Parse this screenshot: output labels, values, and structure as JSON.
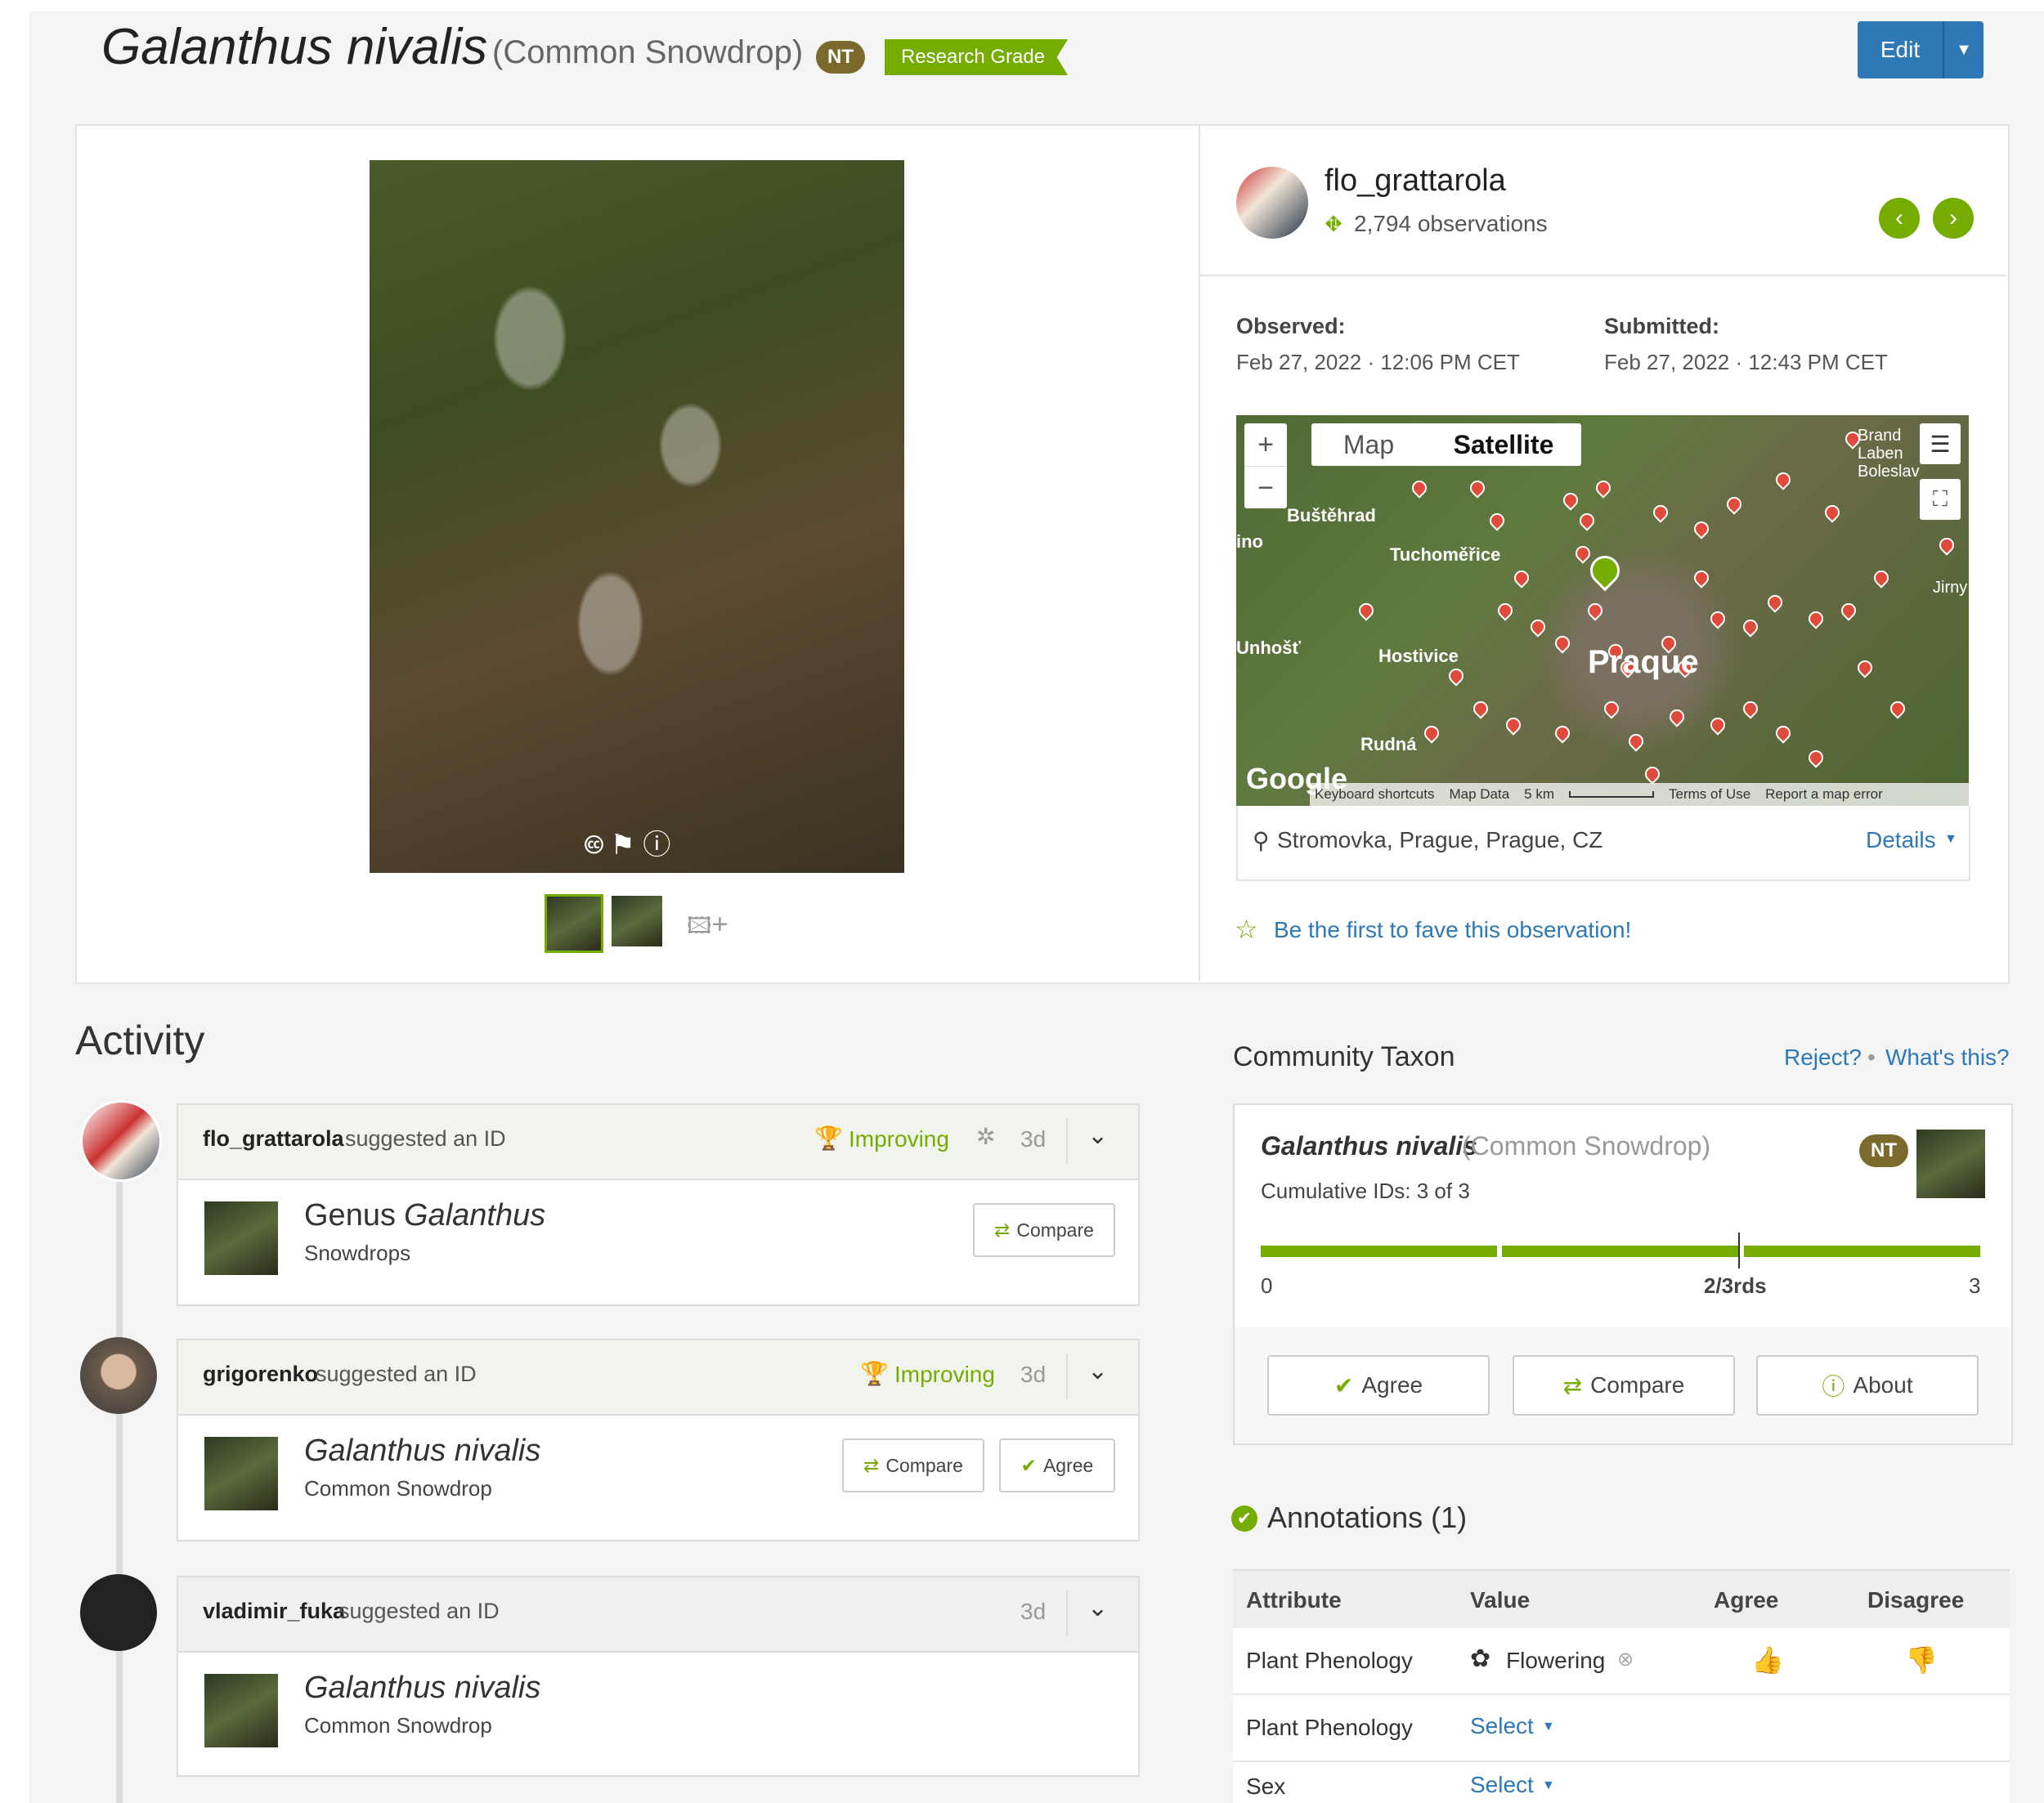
{
  "header": {
    "scientific_name": "Galanthus nivalis",
    "common_name": "(Common Snowdrop)",
    "status_badge": "NT",
    "quality_badge": "Research Grade",
    "edit_label": "Edit"
  },
  "observer": {
    "username": "flo_grattarola",
    "observation_count": "2,794 observations"
  },
  "dates": {
    "observed_label": "Observed:",
    "observed_value": "Feb 27, 2022 · 12:06 PM CET",
    "submitted_label": "Submitted:",
    "submitted_value": "Feb 27, 2022 · 12:43 PM CET"
  },
  "map": {
    "tab_map": "Map",
    "tab_satellite": "Satellite",
    "zoom_in": "+",
    "zoom_out": "−",
    "places": [
      "Buštěhrad",
      "Tuchoměřice",
      "Hostivice",
      "Praque",
      "Rudná",
      "Brand Laben Boleslav",
      "Jirny",
      "Unhošť",
      "ino"
    ],
    "google": "Google",
    "footer_items": [
      "Keyboard shortcuts",
      "Map Data",
      "5 km",
      "Terms of Use",
      "Report a map error"
    ],
    "location": "Stromovka, Prague, Prague, CZ",
    "details_label": "Details"
  },
  "fave_text": "Be the first to fave this observation!",
  "activity": {
    "title": "Activity",
    "items": [
      {
        "user": "flo_grattarola",
        "action": "suggested an ID",
        "status": "Improving",
        "age": "3d",
        "taxon_rank": "Genus",
        "taxon_name": "Galanthus",
        "taxon_common": "Snowdrops",
        "compare": "Compare"
      },
      {
        "user": "grigorenko",
        "action": "suggested an ID",
        "status": "Improving",
        "age": "3d",
        "taxon_name": "Galanthus nivalis",
        "taxon_common": "Common Snowdrop",
        "compare": "Compare",
        "agree": "Agree"
      },
      {
        "user": "vladimir_fuka",
        "action": "suggested an ID",
        "age": "3d",
        "taxon_name": "Galanthus nivalis",
        "taxon_common": "Common Snowdrop"
      }
    ]
  },
  "community": {
    "title": "Community Taxon",
    "reject": "Reject?",
    "whats_this": "What's this?",
    "taxon_name": "Galanthus nivalis",
    "taxon_common": "(Common Snowdrop)",
    "badge": "NT",
    "cumulative": "Cumulative IDs: 3 of 3",
    "scale_min": "0",
    "scale_mid": "2/3rds",
    "scale_max": "3",
    "agree": "Agree",
    "compare": "Compare",
    "about": "About"
  },
  "annotations": {
    "title": "Annotations (1)",
    "headers": [
      "Attribute",
      "Value",
      "Agree",
      "Disagree"
    ],
    "rows": [
      {
        "attribute": "Plant Phenology",
        "value": "Flowering"
      },
      {
        "attribute": "Plant Phenology",
        "value": "Select"
      },
      {
        "attribute": "Sex",
        "value": "Select"
      }
    ]
  },
  "colors": {
    "accent_green": "#74ac00",
    "link_blue": "#2e78b6",
    "nt_badge": "#7a6a2d"
  }
}
